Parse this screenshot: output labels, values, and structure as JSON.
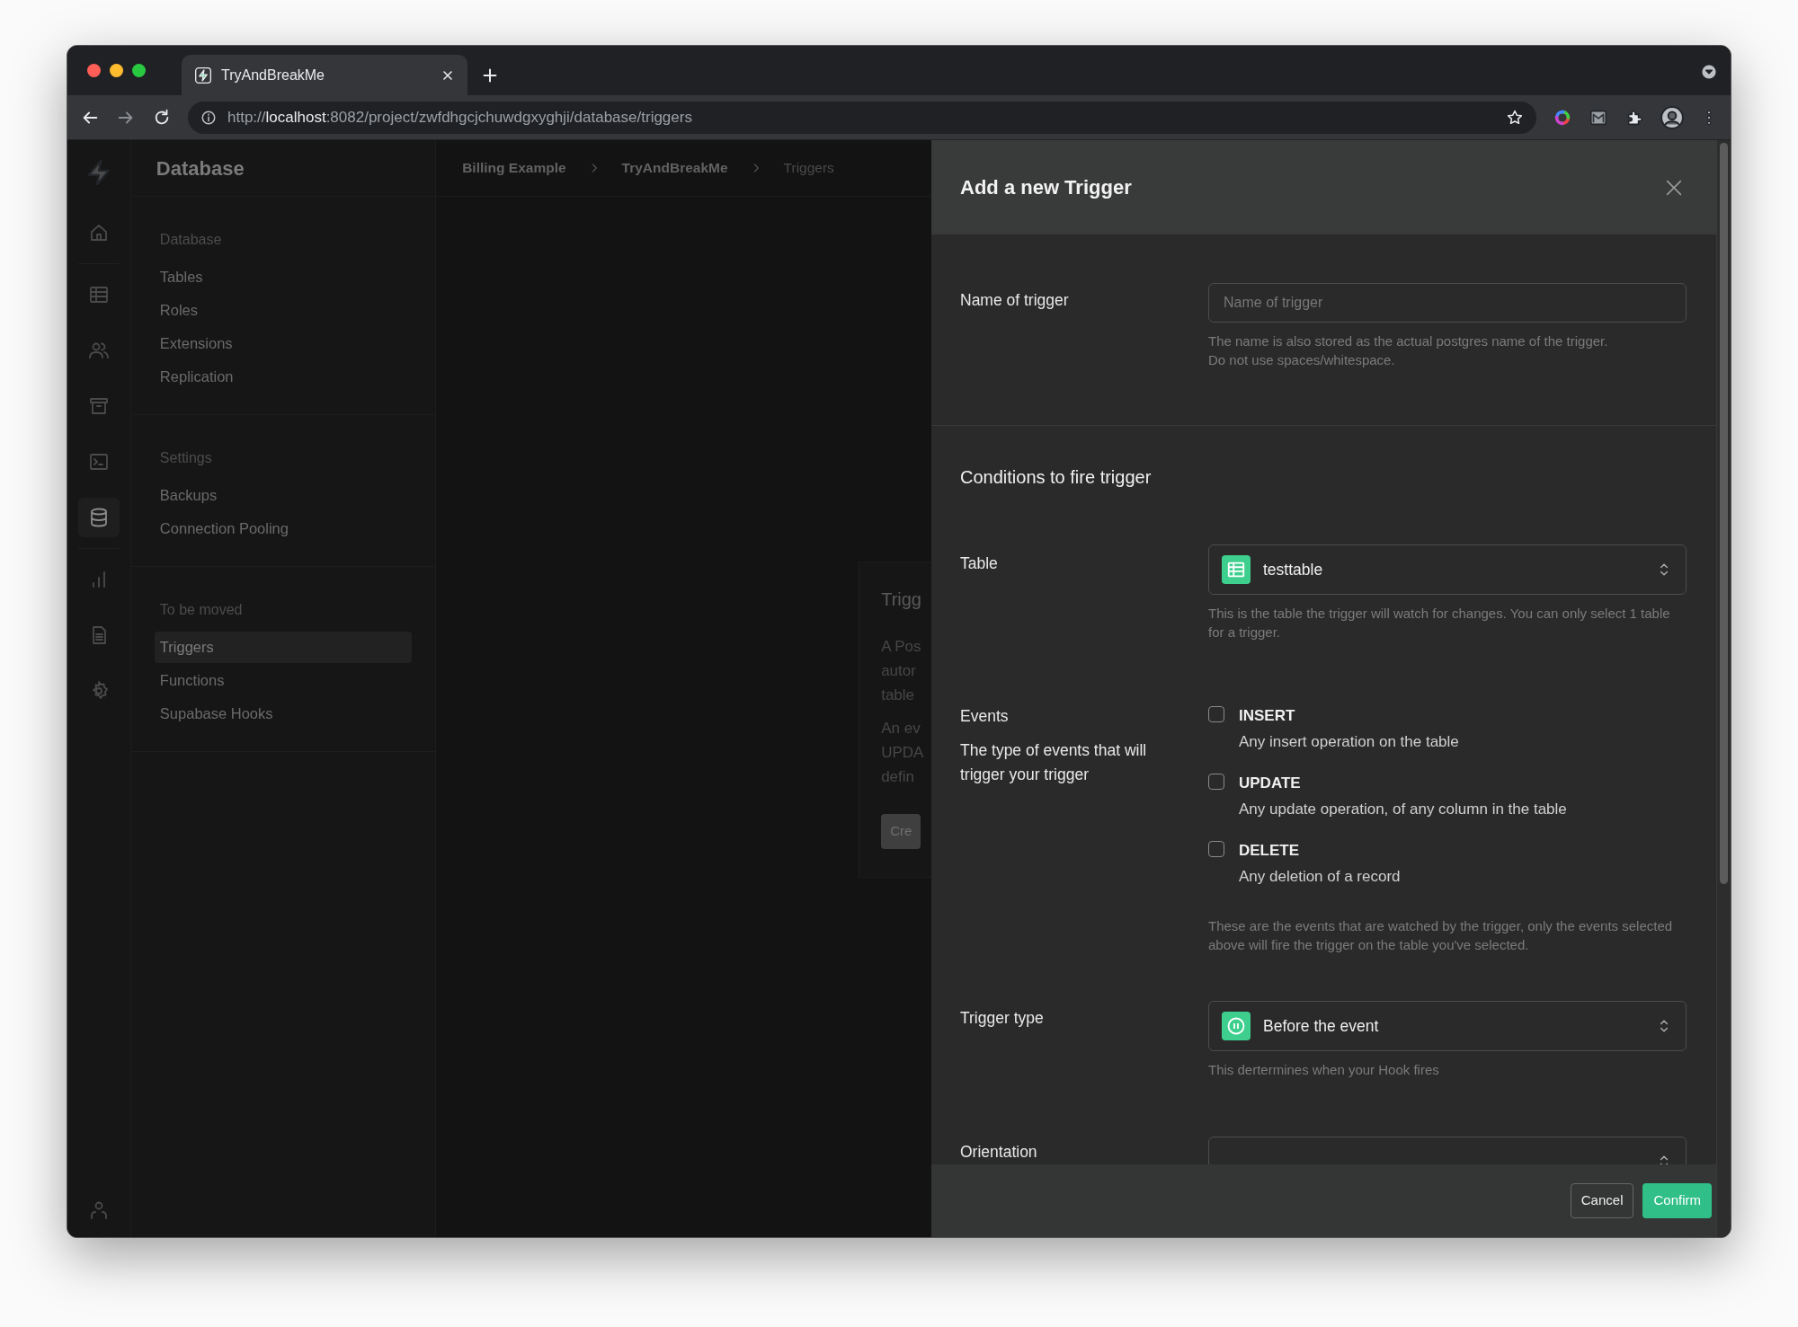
{
  "browser": {
    "tab": {
      "title": "TryAndBreakMe",
      "selected": true
    },
    "url": {
      "scheme": "http://",
      "host": "localhost",
      "path": ":8082/project/zwfdhgcjchuwdgxyghji/database/triggers"
    }
  },
  "rail": [
    [
      {
        "kind": "home",
        "selected": false
      }
    ],
    [
      {
        "kind": "table",
        "selected": false
      },
      {
        "kind": "users",
        "selected": false
      },
      {
        "kind": "archive",
        "selected": false
      },
      {
        "kind": "terminal",
        "selected": false
      },
      {
        "kind": "database",
        "selected": true
      }
    ],
    [
      {
        "kind": "chart",
        "selected": false
      },
      {
        "kind": "document",
        "selected": false
      },
      {
        "kind": "settings",
        "selected": false
      }
    ]
  ],
  "sidebar": {
    "title": "Database",
    "sections": [
      {
        "heading": "Database",
        "items": [
          {
            "label": "Tables",
            "selected": false
          },
          {
            "label": "Roles",
            "selected": false
          },
          {
            "label": "Extensions",
            "selected": false
          },
          {
            "label": "Replication",
            "selected": false
          }
        ]
      },
      {
        "heading": "Settings",
        "items": [
          {
            "label": "Backups",
            "selected": false
          },
          {
            "label": "Connection Pooling",
            "selected": false
          }
        ]
      },
      {
        "heading": "To be moved",
        "items": [
          {
            "label": "Triggers",
            "selected": true
          },
          {
            "label": "Functions",
            "selected": false
          },
          {
            "label": "Supabase Hooks",
            "selected": false
          }
        ]
      }
    ]
  },
  "breadcrumbs": [
    {
      "label": "Billing Example",
      "current": false
    },
    {
      "label": "TryAndBreakMe",
      "current": false
    },
    {
      "label": "Triggers",
      "current": true
    }
  ],
  "background_card": {
    "title": "Trigg",
    "paragraphs": [
      [
        "A Pos",
        "autor",
        "table"
      ],
      [
        "An ev",
        "UPDA",
        "defin"
      ]
    ],
    "button": "Cre"
  },
  "panel": {
    "title": "Add a new Trigger",
    "name_field": {
      "label": "Name of trigger",
      "placeholder": "Name of trigger",
      "help": [
        "The name is also stored as the actual postgres name of the trigger.",
        "Do not use spaces/whitespace."
      ]
    },
    "section_title": "Conditions to fire trigger",
    "table_field": {
      "label": "Table",
      "value": "testtable",
      "help": "This is the table the trigger will watch for changes. You can only select 1 table for a trigger."
    },
    "events": {
      "label": "Events",
      "description": "The type of events that will trigger your trigger",
      "options": [
        {
          "name": "INSERT",
          "description": "Any insert operation on the table",
          "checked": false
        },
        {
          "name": "UPDATE",
          "description": "Any update operation, of any column in the table",
          "checked": false
        },
        {
          "name": "DELETE",
          "description": "Any deletion of a record",
          "checked": false
        }
      ],
      "help": "These are the events that are watched by the trigger, only the events selected above will fire the trigger on the table you've selected."
    },
    "trigger_type": {
      "label": "Trigger type",
      "value": "Before the event",
      "help": "This dertermines when your Hook fires"
    },
    "orientation": {
      "label": "Orientation"
    },
    "buttons": {
      "cancel": "Cancel",
      "confirm": "Confirm"
    }
  }
}
